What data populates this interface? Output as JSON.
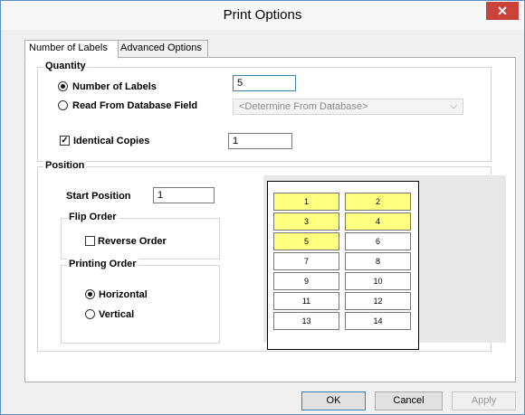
{
  "window": {
    "title": "Print Options",
    "close_glyph": "✕"
  },
  "tabs": [
    {
      "label": "Number of Labels",
      "active": true
    },
    {
      "label": "Advanced Options",
      "active": false
    }
  ],
  "quantity": {
    "group_label": "Quantity",
    "number_of_labels": {
      "label": "Number of Labels",
      "selected": true,
      "value": "5"
    },
    "read_from_db": {
      "label": "Read From Database Field",
      "selected": false,
      "select_value": "<Determine From Database>"
    },
    "identical_copies": {
      "label": "Identical Copies",
      "checked": true,
      "value": "1"
    }
  },
  "position": {
    "group_label": "Position",
    "start_position": {
      "label": "Start Position",
      "value": "1"
    },
    "flip_order": {
      "group_label": "Flip Order",
      "reverse_order": {
        "label": "Reverse Order",
        "checked": false
      }
    },
    "printing_order": {
      "group_label": "Printing Order",
      "horizontal": {
        "label": "Horizontal",
        "selected": true
      },
      "vertical": {
        "label": "Vertical",
        "selected": false
      }
    },
    "preview_cells": [
      {
        "num": "1",
        "filled": true
      },
      {
        "num": "2",
        "filled": true
      },
      {
        "num": "3",
        "filled": true
      },
      {
        "num": "4",
        "filled": true
      },
      {
        "num": "5",
        "filled": true
      },
      {
        "num": "6",
        "filled": false
      },
      {
        "num": "7",
        "filled": false
      },
      {
        "num": "8",
        "filled": false
      },
      {
        "num": "9",
        "filled": false
      },
      {
        "num": "10",
        "filled": false
      },
      {
        "num": "11",
        "filled": false
      },
      {
        "num": "12",
        "filled": false
      },
      {
        "num": "13",
        "filled": false
      },
      {
        "num": "14",
        "filled": false
      }
    ],
    "filled_color": "#ffff7f"
  },
  "buttons": {
    "ok": "OK",
    "cancel": "Cancel",
    "apply": "Apply"
  },
  "colors": {
    "close_button": "#c9433a",
    "accent_border": "#3c7fb1"
  }
}
